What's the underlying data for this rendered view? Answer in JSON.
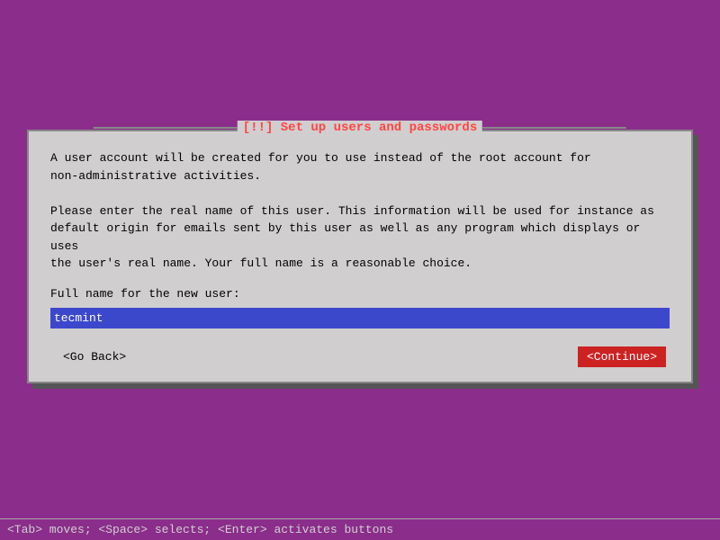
{
  "window": {
    "background_color": "#8b2d8b"
  },
  "dialog": {
    "title": "[!!] Set up users and passwords",
    "description_line1": "A user account will be created for you to use instead of the root account for",
    "description_line2": "non-administrative activities.",
    "description_line3": "Please enter the real name of this user. This information will be used for instance as",
    "description_line4": "default origin for emails sent by this user as well as any program which displays or uses",
    "description_line5": "the user's real name. Your full name is a reasonable choice.",
    "field_label": "Full name for the new user:",
    "input_value": "tecmint",
    "btn_back_label": "<Go Back>",
    "btn_continue_label": "<Continue>"
  },
  "status_bar": {
    "text": "<Tab> moves; <Space> selects; <Enter> activates buttons"
  }
}
